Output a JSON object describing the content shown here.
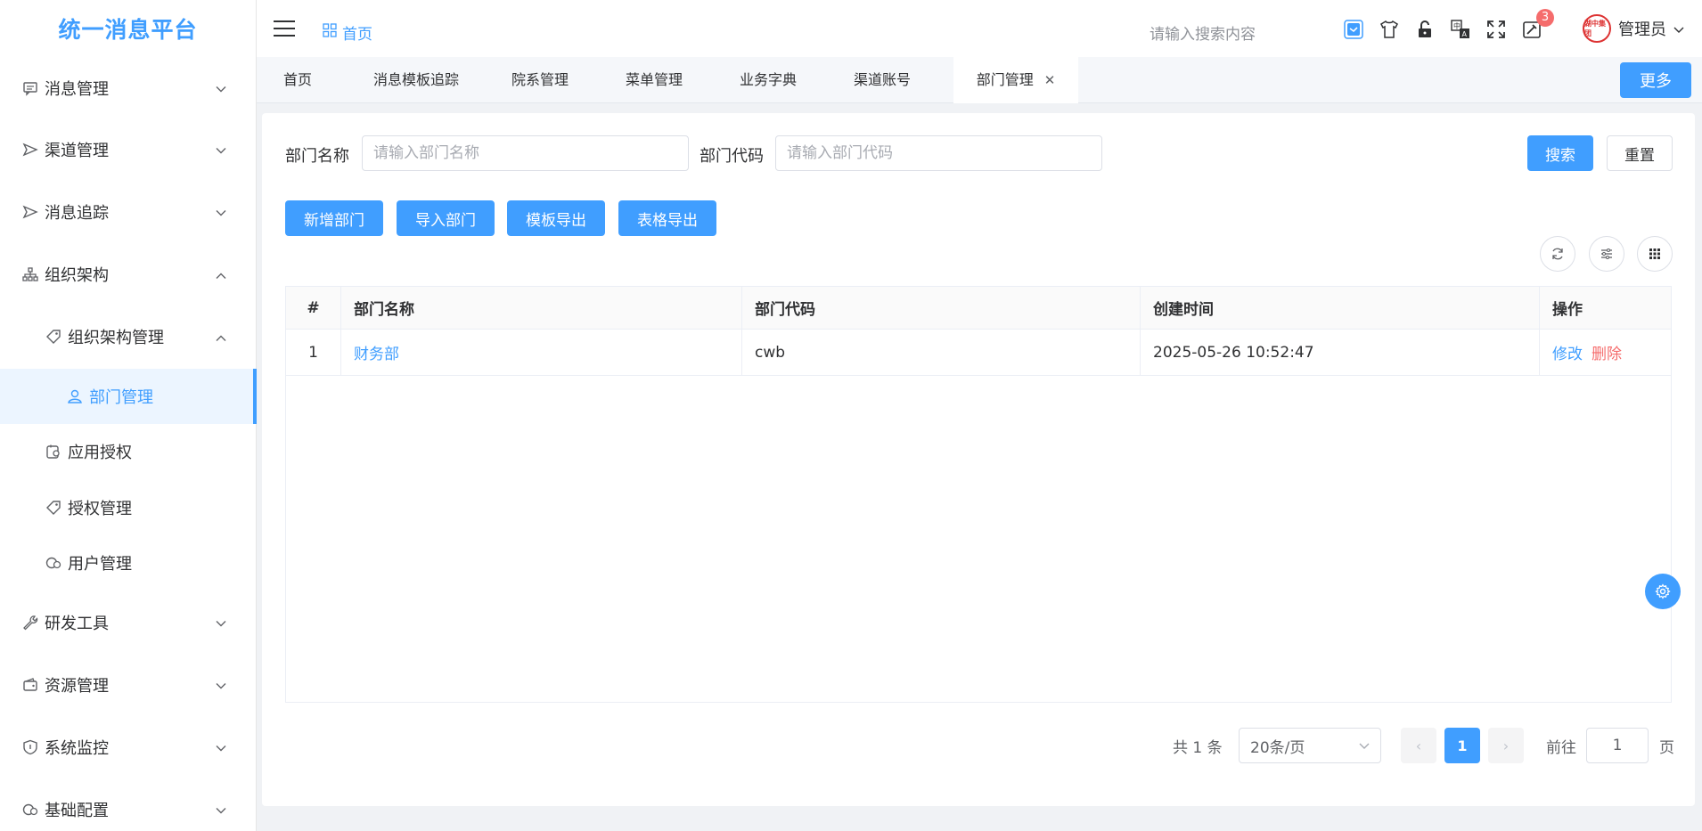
{
  "app": {
    "title": "统一消息平台"
  },
  "sidebar": {
    "items": [
      {
        "label": "消息管理",
        "icon": "message-icon",
        "expanded": false
      },
      {
        "label": "渠道管理",
        "icon": "send-icon",
        "expanded": false
      },
      {
        "label": "消息追踪",
        "icon": "send-icon",
        "expanded": false
      },
      {
        "label": "组织架构",
        "icon": "org-tree-icon",
        "expanded": true
      },
      {
        "label": "组织架构管理",
        "icon": "tag-icon",
        "expanded": true
      },
      {
        "label": "部门管理",
        "icon": "user-icon",
        "active": true
      },
      {
        "label": "应用授权",
        "icon": "app-auth-icon"
      },
      {
        "label": "授权管理",
        "icon": "tag-icon"
      },
      {
        "label": "用户管理",
        "icon": "user-circle-icon"
      },
      {
        "label": "研发工具",
        "icon": "wrench-icon",
        "expanded": false
      },
      {
        "label": "资源管理",
        "icon": "wallet-icon",
        "expanded": false
      },
      {
        "label": "系统监控",
        "icon": "shield-icon",
        "expanded": false
      },
      {
        "label": "基础配置",
        "icon": "config-icon",
        "expanded": false
      }
    ]
  },
  "header": {
    "breadcrumb": "首页",
    "search_placeholder": "请输入搜索内容",
    "notification_count": "3",
    "user_name": "管理员",
    "avatar_text": "湖中集团"
  },
  "tabs": {
    "items": [
      "首页",
      "消息模板追踪",
      "院系管理",
      "菜单管理",
      "业务字典",
      "渠道账号",
      "部门管理"
    ],
    "active": "部门管理",
    "more_label": "更多"
  },
  "search_form": {
    "name_label": "部门名称",
    "name_placeholder": "请输入部门名称",
    "code_label": "部门代码",
    "code_placeholder": "请输入部门代码",
    "search_label": "搜索",
    "reset_label": "重置"
  },
  "toolbar": {
    "add_label": "新增部门",
    "import_label": "导入部门",
    "template_export_label": "模板导出",
    "table_export_label": "表格导出"
  },
  "table": {
    "columns": [
      "#",
      "部门名称",
      "部门代码",
      "创建时间",
      "操作"
    ],
    "rows": [
      {
        "index": "1",
        "name": "财务部",
        "code": "cwb",
        "created": "2025-05-26 10:52:47",
        "edit": "修改",
        "delete": "删除"
      }
    ]
  },
  "pagination": {
    "total_text": "共 1 条",
    "page_size": "20条/页",
    "current_page": "1",
    "goto_prefix": "前往",
    "goto_value": "1",
    "goto_suffix": "页"
  },
  "colors": {
    "primary": "#409eff",
    "danger": "#f56c6c"
  }
}
